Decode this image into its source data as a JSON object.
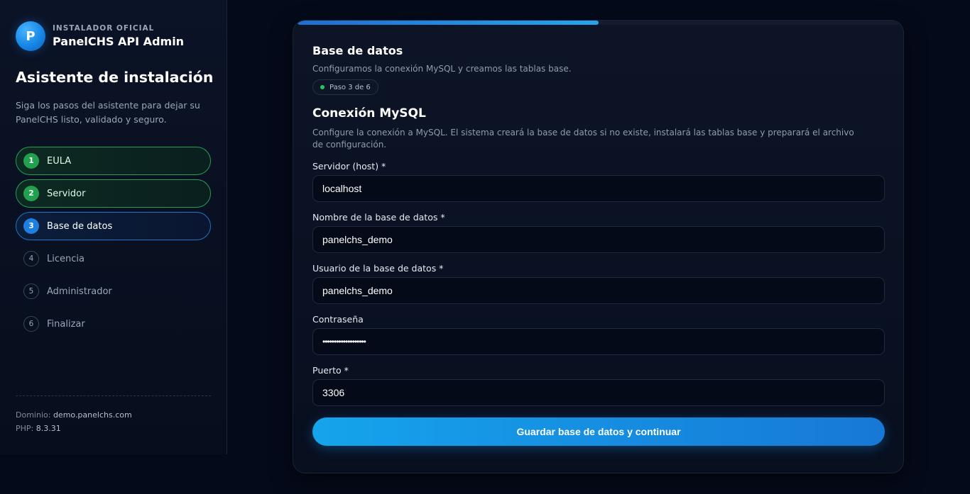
{
  "brand": {
    "logo_letter": "P",
    "kicker": "INSTALADOR OFICIAL",
    "name": "PanelCHS API Admin"
  },
  "sidebar": {
    "title": "Asistente de instalación",
    "description": "Siga los pasos del asistente para dejar su PanelCHS listo, validado y seguro.",
    "steps": [
      {
        "num": "1",
        "label": "EULA",
        "state": "done"
      },
      {
        "num": "2",
        "label": "Servidor",
        "state": "done"
      },
      {
        "num": "3",
        "label": "Base de datos",
        "state": "active"
      },
      {
        "num": "4",
        "label": "Licencia",
        "state": "pending"
      },
      {
        "num": "5",
        "label": "Administrador",
        "state": "pending"
      },
      {
        "num": "6",
        "label": "Finalizar",
        "state": "pending"
      }
    ],
    "meta": {
      "domain_label": "Dominio:",
      "domain_value": "demo.panelchs.com",
      "php_label": "PHP:",
      "php_value": "8.3.31"
    }
  },
  "main": {
    "progress": 0.5,
    "title": "Base de datos",
    "subtitle": "Configuramos la conexión MySQL y creamos las tablas base.",
    "badge": "Paso 3 de 6",
    "section_title": "Conexión MySQL",
    "section_desc": "Configure la conexión a MySQL. El sistema creará la base de datos si no existe, instalará las tablas base y preparará el archivo de configuración.",
    "fields": {
      "host": {
        "label": "Servidor (host) *",
        "value": "localhost"
      },
      "db_name": {
        "label": "Nombre de la base de datos *",
        "value": "panelchs_demo"
      },
      "db_user": {
        "label": "Usuario de la base de datos *",
        "value": "panelchs_demo"
      },
      "password": {
        "label": "Contraseña",
        "value": "•••••••••••••••••••"
      },
      "port": {
        "label": "Puerto *",
        "value": "3306"
      }
    },
    "submit_label": "Guardar base de datos y continuar"
  },
  "colors": {
    "background": "#050a1a",
    "accent": "#1787e6",
    "success": "#22a04f"
  }
}
